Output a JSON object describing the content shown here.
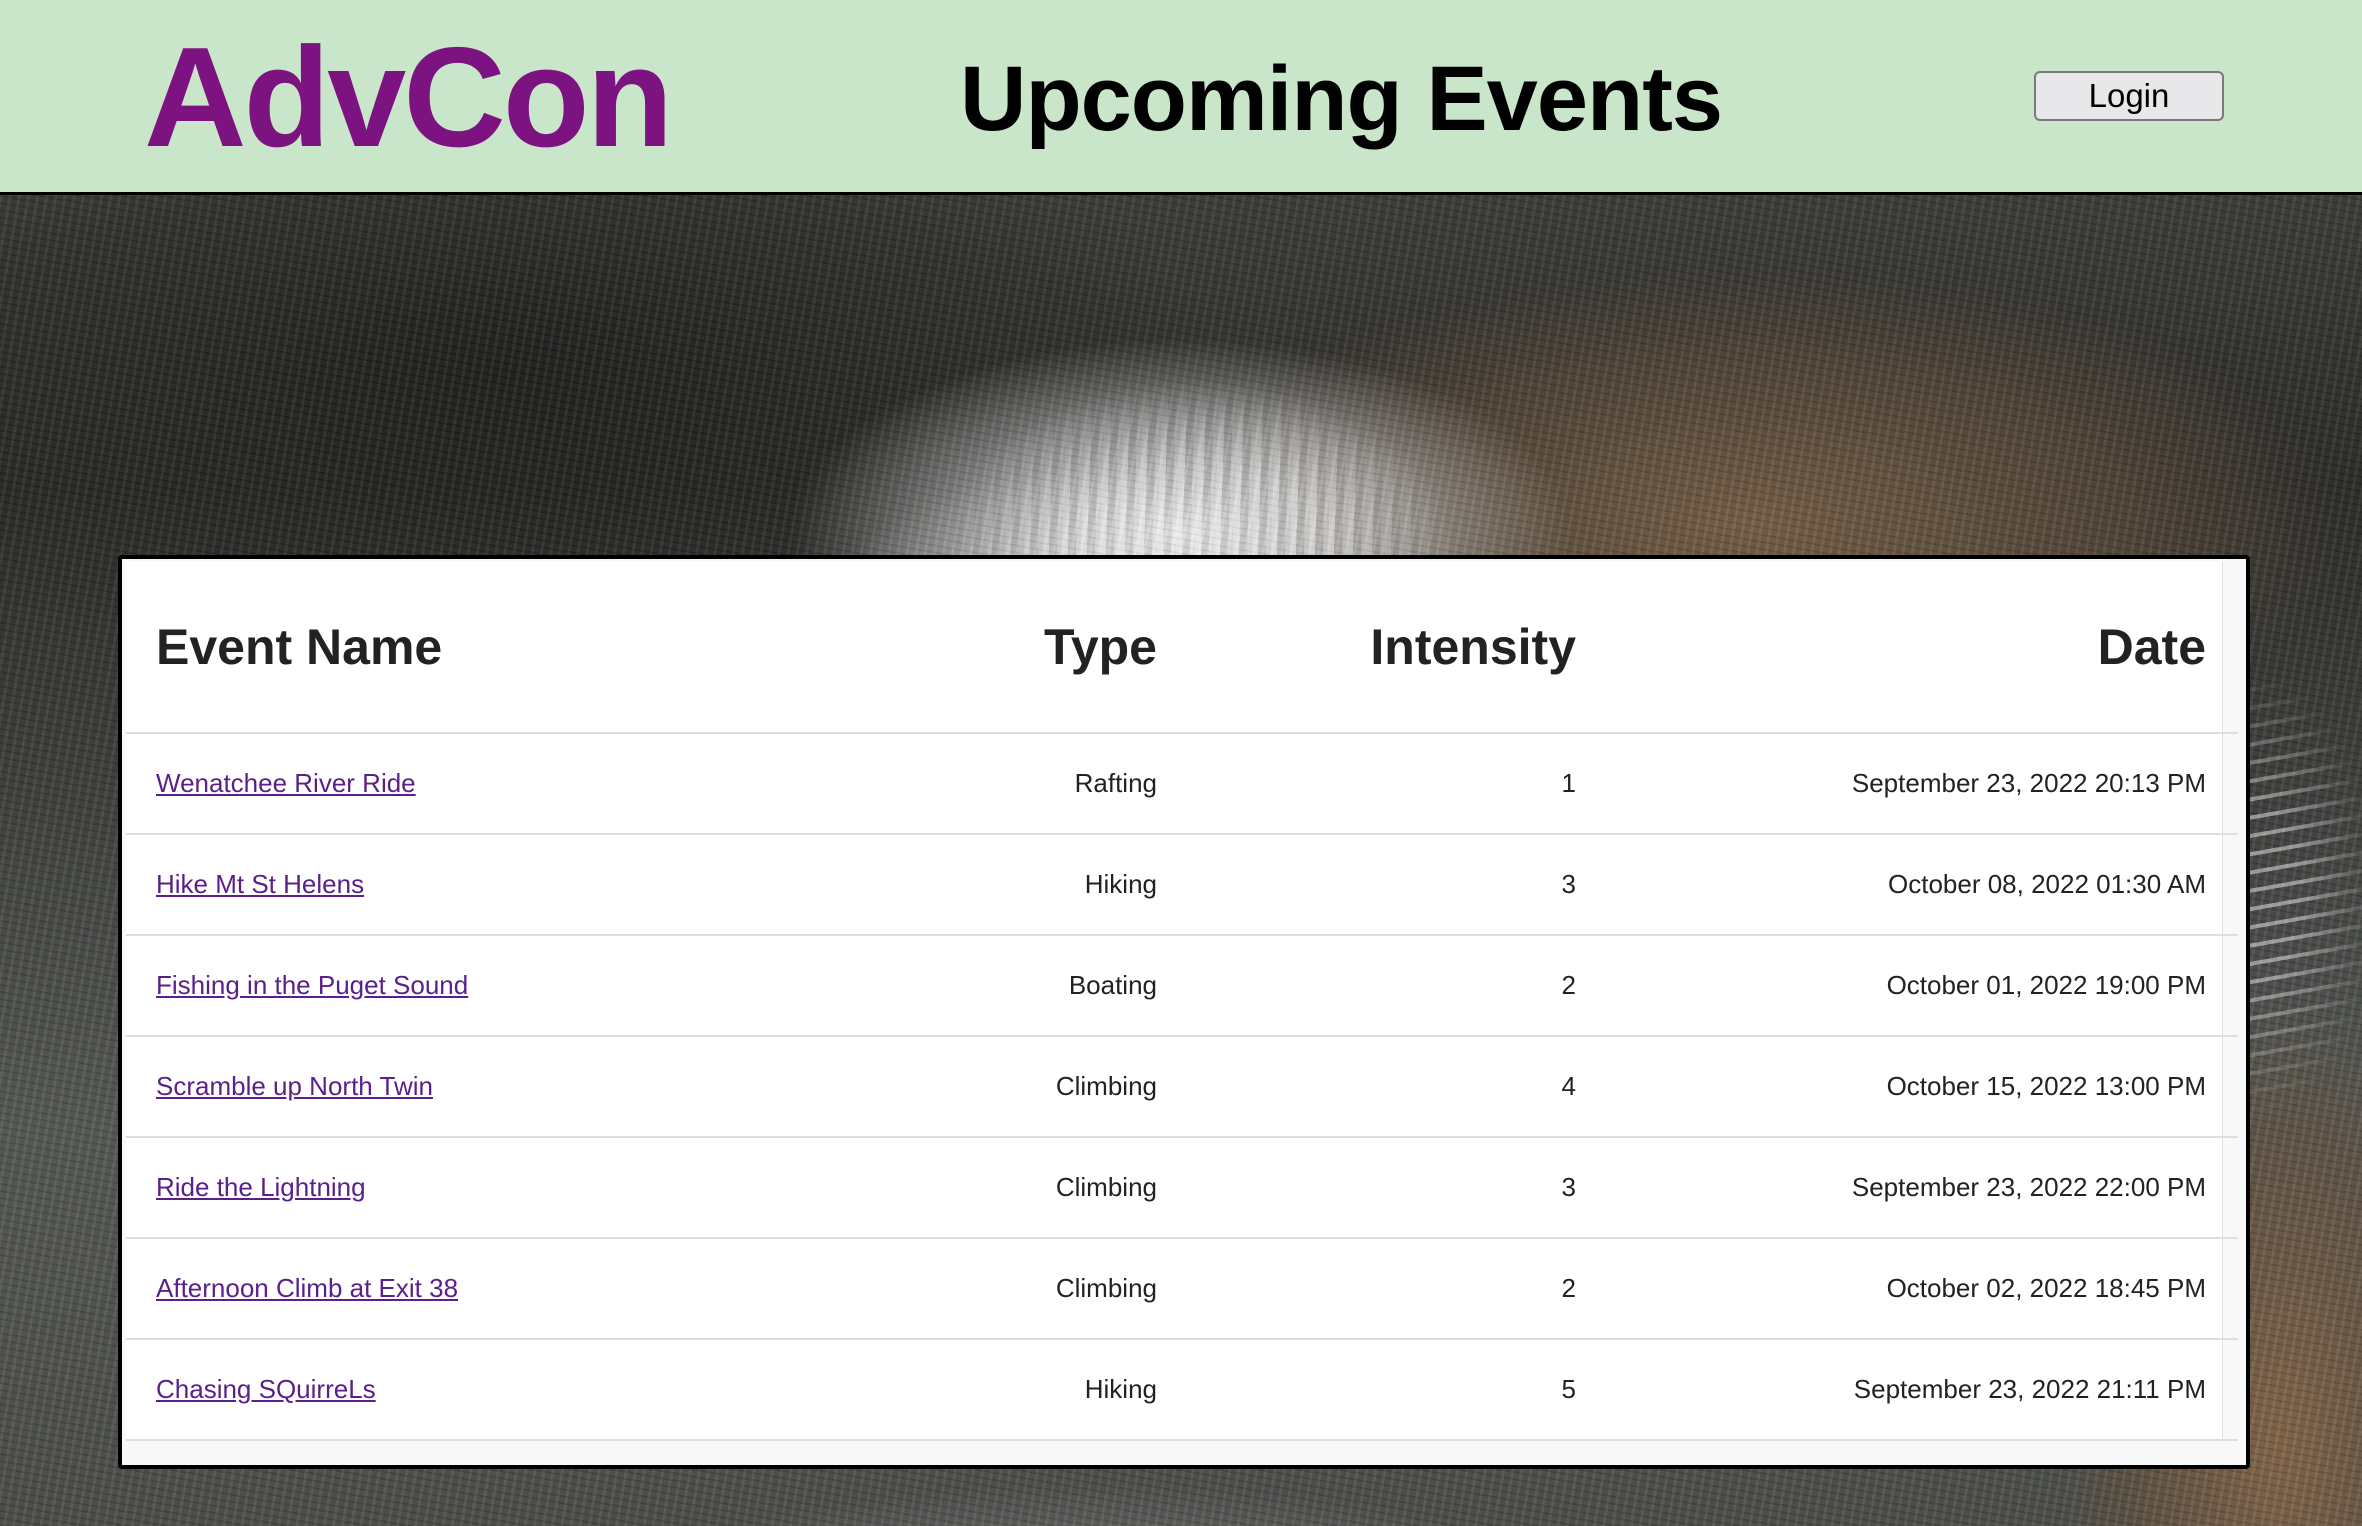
{
  "header": {
    "logo": "AdvCon",
    "title": "Upcoming Events",
    "login_label": "Login",
    "background_color": "#cae6ca",
    "logo_color": "#7c1381"
  },
  "table": {
    "columns": [
      "Event Name",
      "Type",
      "Intensity",
      "Date"
    ],
    "rows": [
      {
        "name": "Wenatchee River Ride",
        "type": "Rafting",
        "intensity": "1",
        "date": "September 23, 2022 20:13 PM"
      },
      {
        "name": "Hike Mt St Helens",
        "type": "Hiking",
        "intensity": "3",
        "date": "October 08, 2022 01:30 AM"
      },
      {
        "name": "Fishing in the Puget Sound",
        "type": "Boating",
        "intensity": "2",
        "date": "October 01, 2022 19:00 PM"
      },
      {
        "name": "Scramble up North Twin",
        "type": "Climbing",
        "intensity": "4",
        "date": "October 15, 2022 13:00 PM"
      },
      {
        "name": "Ride the Lightning",
        "type": "Climbing",
        "intensity": "3",
        "date": "September 23, 2022 22:00 PM"
      },
      {
        "name": "Afternoon Climb at Exit 38",
        "type": "Climbing",
        "intensity": "2",
        "date": "October 02, 2022 18:45 PM"
      },
      {
        "name": "Chasing SQuirreLs",
        "type": "Hiking",
        "intensity": "5",
        "date": "September 23, 2022 21:11 PM"
      }
    ],
    "link_color": "#5a1f8a"
  }
}
